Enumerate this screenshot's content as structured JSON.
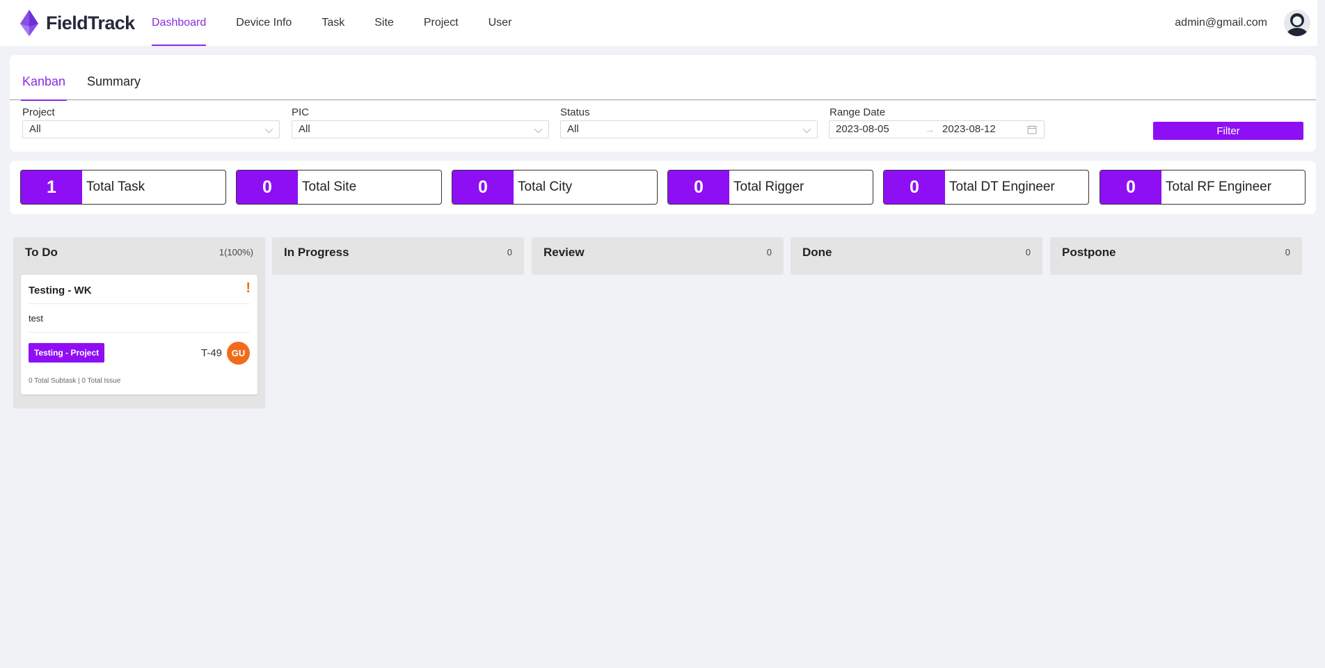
{
  "app": {
    "name": "FieldTrack",
    "user_email": "admin@gmail.com"
  },
  "nav": {
    "items": [
      {
        "label": "Dashboard",
        "active": true
      },
      {
        "label": "Device Info",
        "active": false
      },
      {
        "label": "Task",
        "active": false
      },
      {
        "label": "Site",
        "active": false
      },
      {
        "label": "Project",
        "active": false
      },
      {
        "label": "User",
        "active": false
      }
    ]
  },
  "tabs": [
    {
      "label": "Kanban",
      "active": true
    },
    {
      "label": "Summary",
      "active": false
    }
  ],
  "filters": {
    "project": {
      "label": "Project",
      "value": "All"
    },
    "pic": {
      "label": "PIC",
      "value": "All"
    },
    "status": {
      "label": "Status",
      "value": "All"
    },
    "range": {
      "label": "Range Date",
      "start": "2023-08-05",
      "end": "2023-08-12",
      "separator": "→"
    },
    "button_label": "Filter"
  },
  "stats": [
    {
      "value": "1",
      "label": "Total Task"
    },
    {
      "value": "0",
      "label": "Total Site"
    },
    {
      "value": "0",
      "label": "Total City"
    },
    {
      "value": "0",
      "label": "Total Rigger"
    },
    {
      "value": "0",
      "label": "Total DT Engineer"
    },
    {
      "value": "0",
      "label": "Total RF Engineer"
    }
  ],
  "kanban": {
    "columns": [
      {
        "title": "To Do",
        "count": "1(100%)",
        "cards": [
          {
            "title": "Testing - WK",
            "priority_mark": "!",
            "description": "test",
            "project_tag": "Testing - Project",
            "id": "T-49",
            "assignee_initials": "GU",
            "footer": "0 Total Subtask | 0 Total Issue"
          }
        ]
      },
      {
        "title": "In Progress",
        "count": "0",
        "cards": []
      },
      {
        "title": "Review",
        "count": "0",
        "cards": []
      },
      {
        "title": "Done",
        "count": "0",
        "cards": []
      },
      {
        "title": "Postpone",
        "count": "0",
        "cards": []
      }
    ]
  },
  "colors": {
    "accent": "#8a2be2",
    "primary_button": "#8f0ff5",
    "priority": "#f26b1d",
    "column_bg": "#e4e4e4",
    "page_bg": "#f0f2f5"
  },
  "icons": {
    "logo": "fieldtrack-logo-icon",
    "avatar": "user-avatar-icon",
    "calendar": "calendar-icon",
    "dropdown": "chevron-down-icon",
    "priority": "exclamation-icon"
  }
}
